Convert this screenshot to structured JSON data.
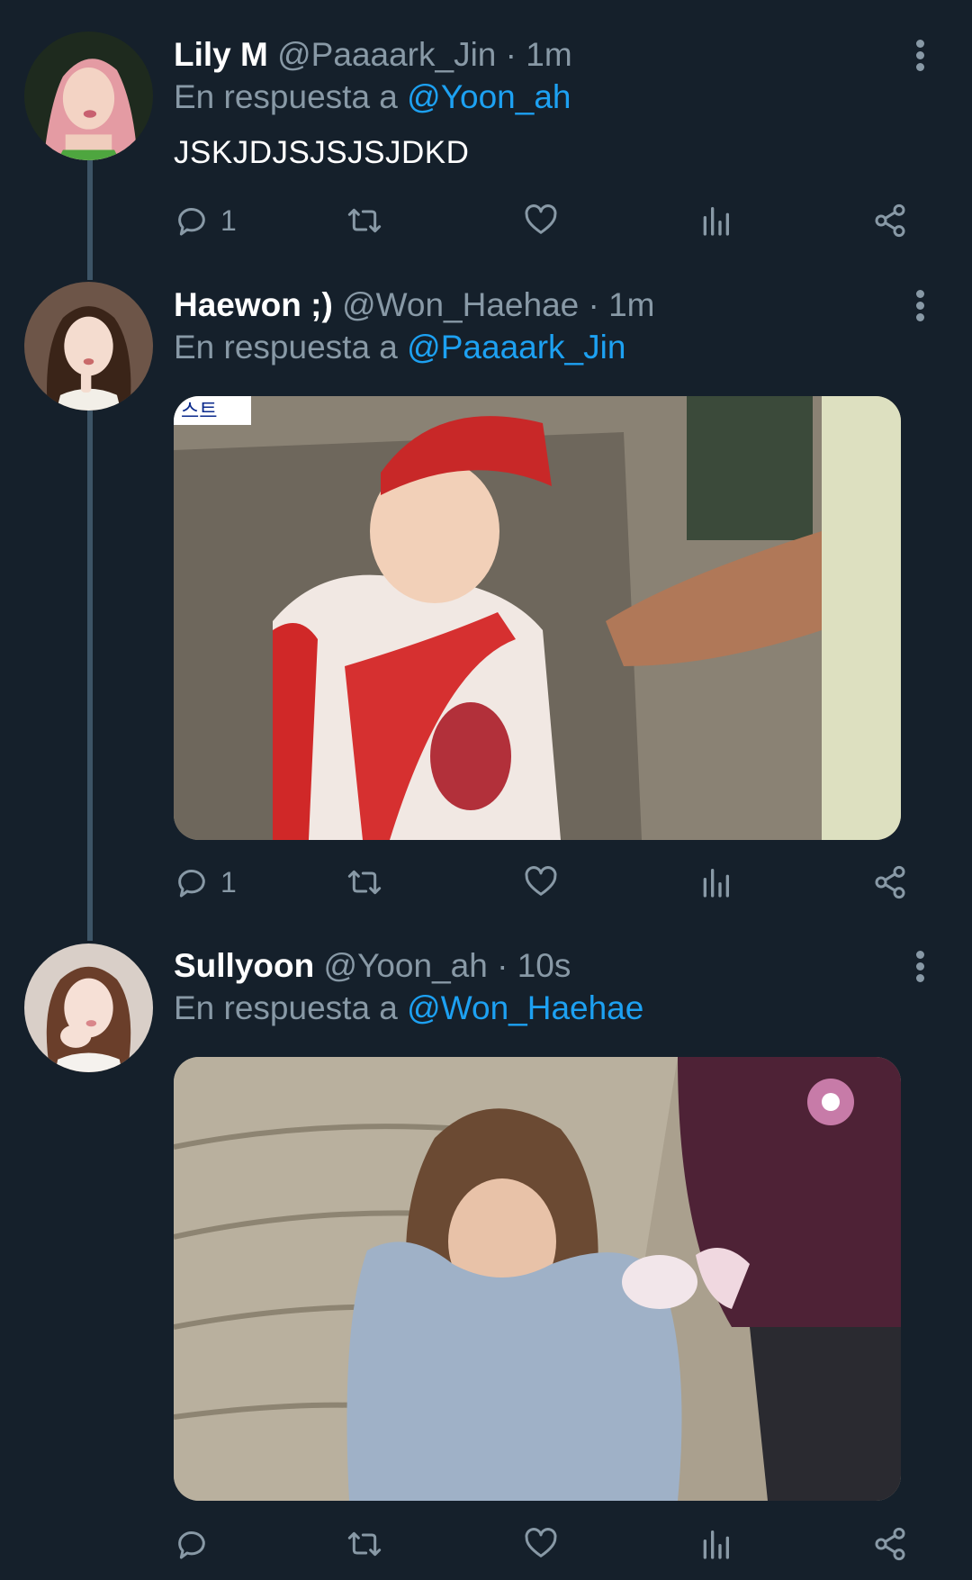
{
  "tweets": [
    {
      "name": "Lily M",
      "handle": "@Paaaark_Jin",
      "time": "1m",
      "reply_prefix": "En respuesta a",
      "reply_to": "@Yoon_ah",
      "text": "JSKJDJSJSJSJDKD",
      "reply_count": "1",
      "has_media": false
    },
    {
      "name": "Haewon ;)",
      "handle": "@Won_Haehae",
      "time": "1m",
      "reply_prefix": "En respuesta a",
      "reply_to": "@Paaaark_Jin",
      "reply_count": "1",
      "media_overlay_text": "스트",
      "has_media": true
    },
    {
      "name": "Sullyoon",
      "handle": "@Yoon_ah",
      "time": "10s",
      "reply_prefix": "En respuesta a",
      "reply_to": "@Won_Haehae",
      "reply_count": "",
      "has_media": true
    }
  ],
  "separator": "·",
  "icons": {
    "reply": "reply-icon",
    "retweet": "retweet-icon",
    "like": "heart-icon",
    "analytics": "analytics-icon",
    "share": "share-icon",
    "more": "more-vertical-icon"
  },
  "colors": {
    "background": "#15202b",
    "secondary_text": "#8899a6",
    "link": "#1da1f2",
    "thread_line": "#3d5466"
  }
}
